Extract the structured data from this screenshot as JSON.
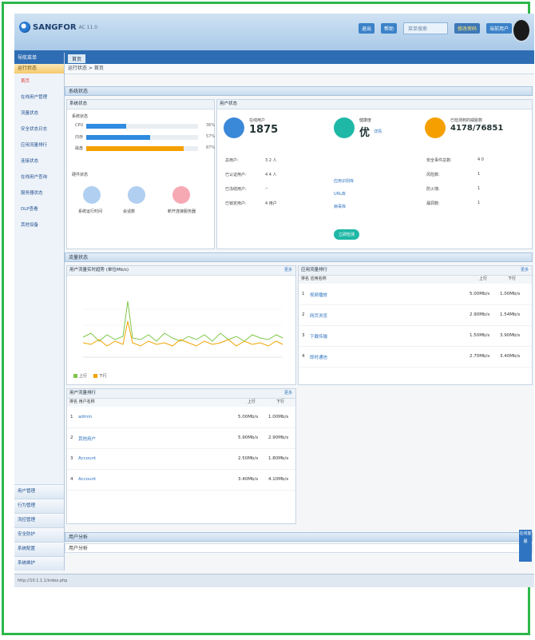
{
  "app": {
    "brand": "SANGFOR",
    "brand_sub": "AC 11.0",
    "top_links": [
      "退出",
      "帮助",
      "修改密码",
      "当前用户"
    ],
    "search_placeholder": "菜单搜索"
  },
  "sidebar": {
    "header": "导航菜单",
    "group": "运行状态",
    "items": [
      "首页",
      "在线用户管理",
      "流量状态",
      "安全状态日志",
      "应用流量排行",
      "连接状态",
      "在线用户查询",
      "服务器状态",
      "DLP查看",
      "其他设备"
    ],
    "bottom": [
      "用户管理",
      "行为管理",
      "流控管理",
      "安全防护",
      "系统配置",
      "系统维护"
    ]
  },
  "tab": {
    "label": "首页"
  },
  "breadcrumb": "运行状态 > 首页",
  "sections": {
    "system": "系统状态",
    "traffic": "流量状态",
    "bottom": "用户分析"
  },
  "system_panel": {
    "title": "系统状态",
    "bars_label": "系统状态",
    "bars": [
      {
        "label": "CPU",
        "value": 36,
        "pct": "36%",
        "color": "#2f8be0"
      },
      {
        "label": "内存",
        "value": 57,
        "pct": "57%",
        "color": "#2f8be0"
      },
      {
        "label": "磁盘",
        "value": 87,
        "pct": "87%",
        "color": "#f5a000"
      }
    ],
    "devices_label": "硬件状态",
    "devices": [
      {
        "label": "系统运行时间",
        "color": "#6fa7e6"
      },
      {
        "label": "会话数",
        "color": "#6fa7e6"
      },
      {
        "label": "断开连接服务器",
        "color": "#f06275"
      }
    ]
  },
  "user_panel": {
    "title": "用户状态",
    "online_label": "在线用户",
    "online_value": "1875",
    "kv": [
      {
        "k": "总用户:",
        "v": "3 2 人"
      },
      {
        "k": "已认证用户:",
        "v": "4 4 人"
      },
      {
        "k": "已冻结用户:",
        "v": "--"
      },
      {
        "k": "已锁定用户:",
        "v": "4 用户"
      }
    ],
    "health_label": "健康度",
    "health_value": "优",
    "health_link": "详情",
    "threat_label": "已检测到的威胁数",
    "threat_value": "4178/76851",
    "mid_rows": [
      "应用识别库",
      "URL库",
      "病毒库"
    ],
    "scan_btn": "立即检测",
    "right_items": [
      {
        "k": "安全事件总数:",
        "v": "4 0"
      },
      {
        "k": "风险数:",
        "v": "1"
      },
      {
        "k": "防火墙:",
        "v": "1"
      },
      {
        "k": "漏洞数:",
        "v": "1"
      }
    ]
  },
  "traffic_chart": {
    "title": "用户流量实时趋势 (单位Mb/s)",
    "more": "更多",
    "legend": [
      {
        "name": "上行",
        "color": "#7fc64a"
      },
      {
        "name": "下行",
        "color": "#f0a500"
      }
    ]
  },
  "top_apps": {
    "title": "应用流量排行",
    "more": "更多",
    "header": [
      "排名 应用名称",
      "上行",
      "下行"
    ],
    "rows": [
      {
        "rank": "1",
        "name": "视频播放",
        "up": "5.00Mb/s",
        "down": "1.00Mb/s"
      },
      {
        "rank": "2",
        "name": "网页浏览",
        "up": "2.90Mb/s",
        "down": "1.54Mb/s"
      },
      {
        "rank": "3",
        "name": "下载传输",
        "up": "1.50Mb/s",
        "down": "3.90Mb/s"
      },
      {
        "rank": "4",
        "name": "即时通信",
        "up": "2.70Mb/s",
        "down": "3.40Mb/s"
      }
    ]
  },
  "top_users": {
    "title": "用户流量排行",
    "more": "更多",
    "header": [
      "排名 用户名称",
      "上行",
      "下行"
    ],
    "rows": [
      {
        "rank": "1",
        "name": "admin",
        "up": "5.00Mb/s",
        "down": "1.00Mb/s"
      },
      {
        "rank": "2",
        "name": "其他用户",
        "up": "5.90Mb/s",
        "down": "2.90Mb/s"
      },
      {
        "rank": "3",
        "name": "Account",
        "up": "2.50Mb/s",
        "down": "1.80Mb/s"
      },
      {
        "rank": "4",
        "name": "Account",
        "up": "3.40Mb/s",
        "down": "4.10Mb/s"
      }
    ]
  },
  "bottom_section_row": "用户分析",
  "float_btn": "在线客服",
  "status_text": "http://10.1.1.1/index.php"
}
